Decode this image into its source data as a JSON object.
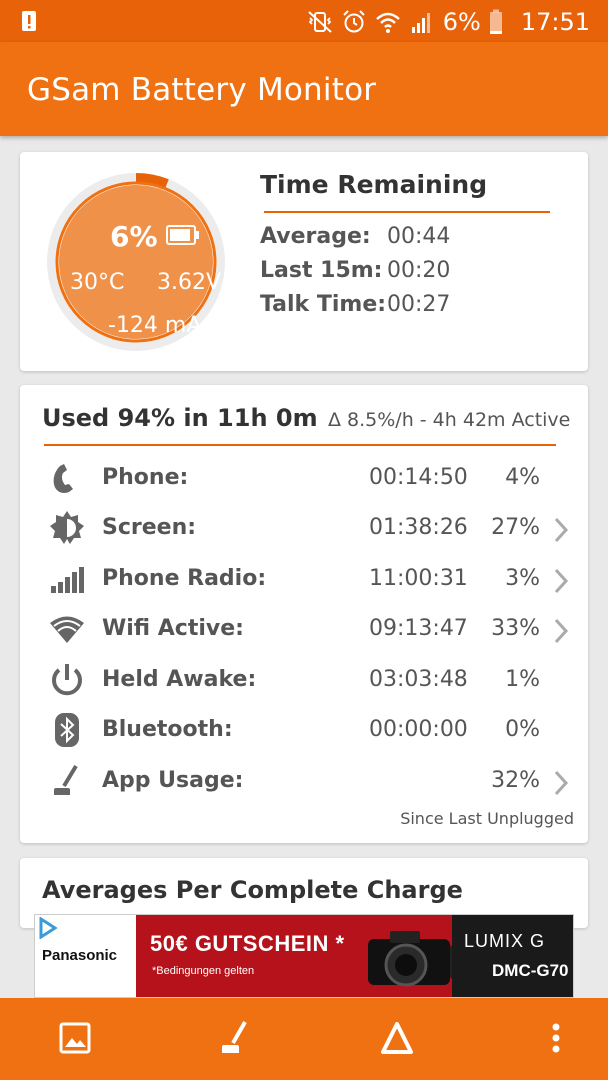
{
  "status_bar": {
    "battery_percent": "6%",
    "time": "17:51",
    "icons": [
      "alert-icon",
      "mute-vibrate-icon",
      "alarm-icon",
      "wifi-icon",
      "signal-icon",
      "battery-icon"
    ]
  },
  "app_bar": {
    "title": "GSam Battery Monitor"
  },
  "battery_gauge": {
    "percent": "6%",
    "level": 0.06,
    "temperature": "30°C",
    "voltage": "3.62V",
    "current": "-124 mA"
  },
  "time_remaining": {
    "title": "Time Remaining",
    "rows": [
      {
        "label": "Average:",
        "value": "00:44"
      },
      {
        "label": "Last 15m:",
        "value": "00:20"
      },
      {
        "label": "Talk Time:",
        "value": "00:27"
      }
    ]
  },
  "usage": {
    "title": "Used 94% in 11h 0m",
    "subtitle": "Δ 8.5%/h - 4h 42m Active",
    "rows": [
      {
        "icon": "phone-icon",
        "name": "Phone:",
        "time": "00:14:50",
        "percent": "4%",
        "chevron": false
      },
      {
        "icon": "screen-brightness-icon",
        "name": "Screen:",
        "time": "01:38:26",
        "percent": "27%",
        "chevron": true
      },
      {
        "icon": "signal-bars-icon",
        "name": "Phone Radio:",
        "time": "11:00:31",
        "percent": "3%",
        "chevron": true
      },
      {
        "icon": "wifi-icon",
        "name": "Wifi Active:",
        "time": "09:13:47",
        "percent": "33%",
        "chevron": true
      },
      {
        "icon": "power-icon",
        "name": "Held Awake:",
        "time": "03:03:48",
        "percent": "1%",
        "chevron": false
      },
      {
        "icon": "bluetooth-icon",
        "name": "Bluetooth:",
        "time": "00:00:00",
        "percent": "0%",
        "chevron": false
      },
      {
        "icon": "app-usage-icon",
        "name": "App Usage:",
        "time": "",
        "percent": "32%",
        "chevron": true
      }
    ],
    "footer": "Since Last Unplugged"
  },
  "averages": {
    "title": "Averages Per Complete Charge"
  },
  "ad": {
    "brand": "Panasonic",
    "offer": "50€ GUTSCHEIN *",
    "note": "*Bedingungen gelten",
    "product_line1": "LUMIX G",
    "product_line2": "DMC-G70"
  },
  "bottom_bar": {
    "buttons": [
      "gallery-icon",
      "app-usage-icon",
      "delta-icon",
      "more-vert-icon"
    ]
  },
  "colors": {
    "status_bar": "#e8620a",
    "app_bar": "#f07112",
    "gauge_fill": "#f0904a",
    "gauge_ring": "#f07112",
    "accent_line": "#e8620a"
  }
}
